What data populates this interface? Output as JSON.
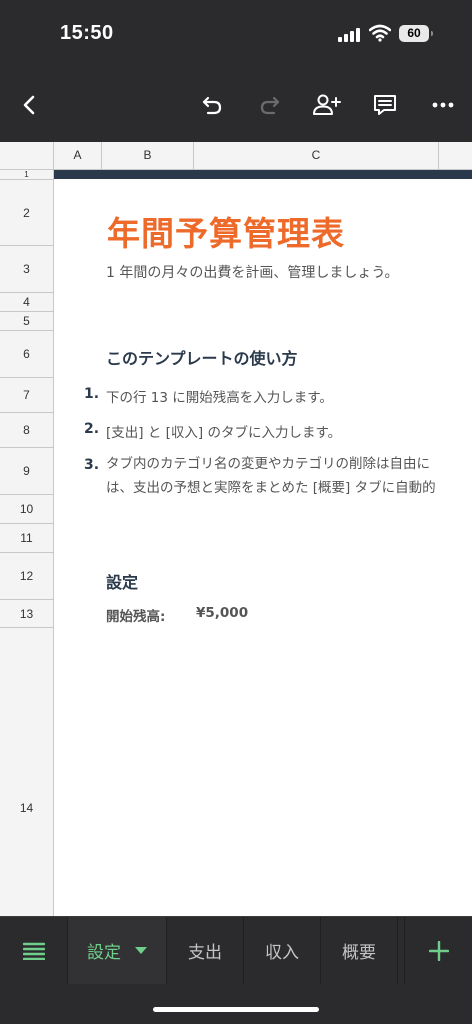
{
  "status": {
    "time": "15:50",
    "battery": "60"
  },
  "toolbar": {
    "icons": [
      "back-icon",
      "undo-icon",
      "redo-icon",
      "add-person-icon",
      "comment-icon",
      "more-icon"
    ]
  },
  "sheet": {
    "columns": [
      "A",
      "B",
      "C"
    ],
    "rows": [
      "1",
      "2",
      "3",
      "4",
      "5",
      "6",
      "7",
      "8",
      "9",
      "10",
      "11",
      "12",
      "13",
      "14"
    ],
    "title": "年間予算管理表",
    "subtitle": "1 年間の月々の出費を計画、管理しましょう。",
    "howto_heading": "このテンプレートの使い方",
    "steps": [
      {
        "num": "1.",
        "text": "下の行 13 に開始残高を入力します。"
      },
      {
        "num": "2.",
        "text": "[支出] と [収入] のタブに入力します。"
      },
      {
        "num": "3.",
        "line1": "タブ内のカテゴリ名の変更やカテゴリの削除は自由に",
        "line2": "は、支出の予想と実際をまとめた [概要] タブに自動的"
      }
    ],
    "settings_heading": "設定",
    "settings_label": "開始残高:",
    "settings_value": "¥5,000"
  },
  "tabs": {
    "menu_icon": "sheets-list-icon",
    "items": [
      "設定",
      "支出",
      "収入",
      "概要"
    ],
    "active": "設定",
    "add_icon": "plus-icon"
  },
  "colors": {
    "accent": "#ee6a2a",
    "heading": "#2a3a4c",
    "active_tab": "#6fcf8a"
  }
}
